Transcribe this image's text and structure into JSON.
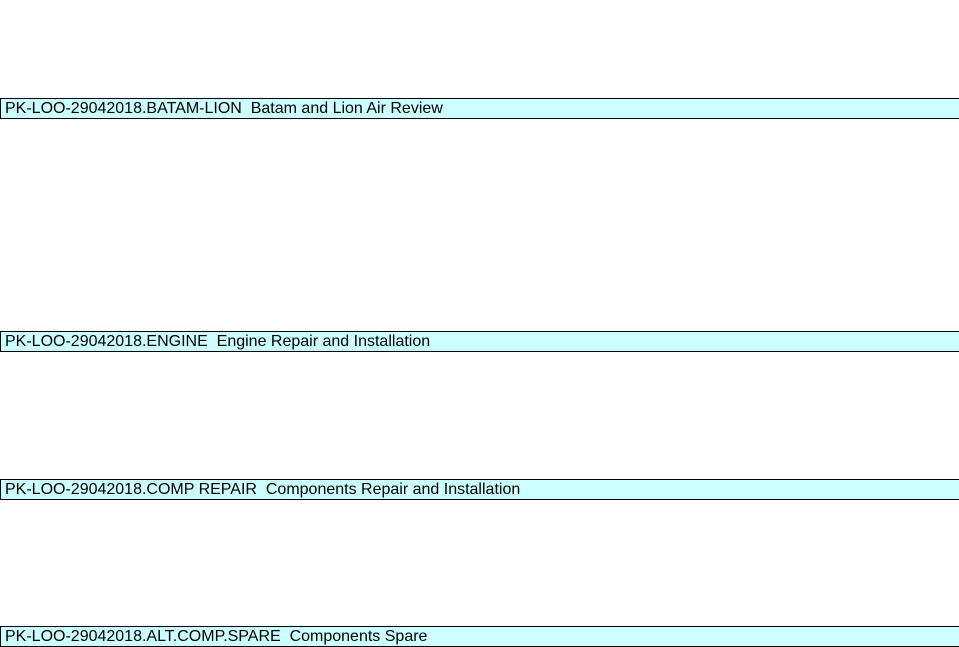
{
  "sections": [
    {
      "code": "PK-LOO-29042018.BATAM-LION",
      "title": "Batam and Lion Air Review"
    },
    {
      "code": "PK-LOO-29042018.ENGINE",
      "title": "Engine Repair and Installation"
    },
    {
      "code": "PK-LOO-29042018.COMP REPAIR",
      "title": "Components Repair and Installation"
    },
    {
      "code": "PK-LOO-29042018.ALT.COMP.SPARE",
      "title": "Components Spare"
    }
  ],
  "colors": {
    "row_background": "#ccffff",
    "row_border": "#000000"
  }
}
